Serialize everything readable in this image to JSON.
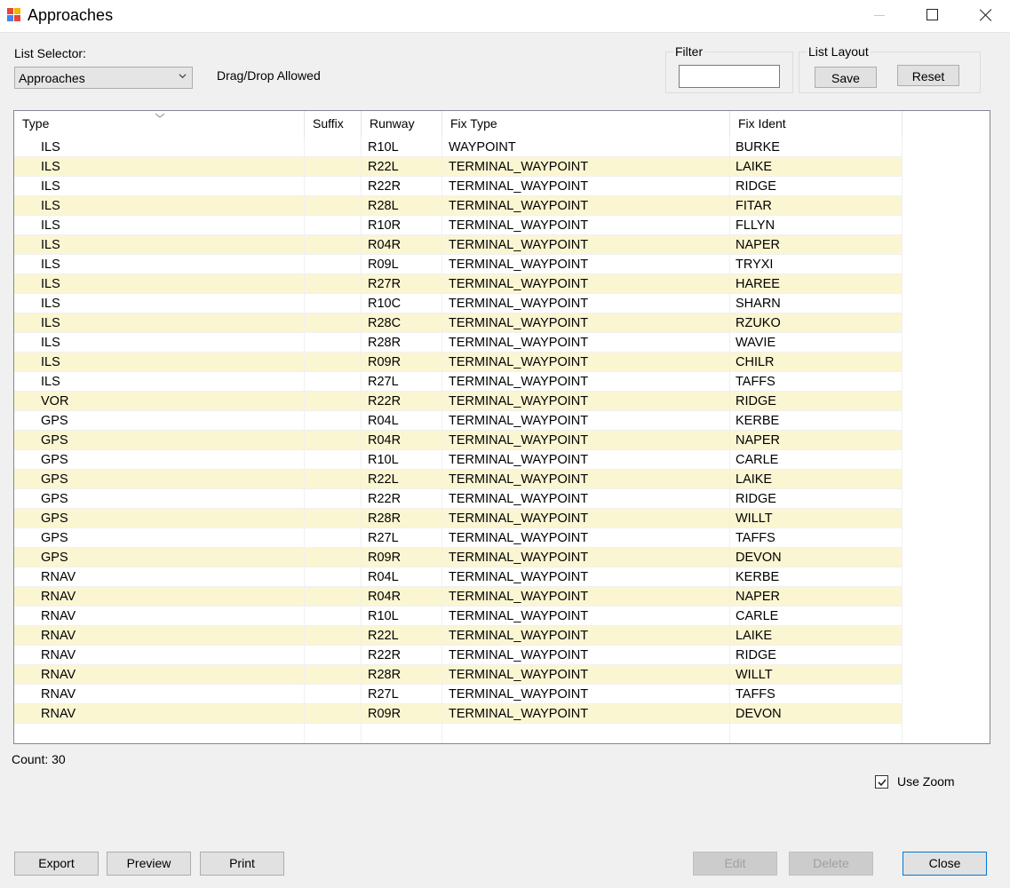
{
  "window": {
    "title": "Approaches"
  },
  "list_selector": {
    "label": "List Selector:",
    "value": "Approaches",
    "note": "Drag/Drop Allowed"
  },
  "filter": {
    "label": "Filter",
    "value": ""
  },
  "list_layout": {
    "label": "List Layout",
    "save_label": "Save",
    "reset_label": "Reset"
  },
  "grid": {
    "columns": [
      "Type",
      "Suffix",
      "Runway",
      "Fix Type",
      "Fix Ident"
    ],
    "rows": [
      [
        "ILS",
        "",
        "R10L",
        "WAYPOINT",
        "BURKE"
      ],
      [
        "ILS",
        "",
        "R22L",
        "TERMINAL_WAYPOINT",
        "LAIKE"
      ],
      [
        "ILS",
        "",
        "R22R",
        "TERMINAL_WAYPOINT",
        "RIDGE"
      ],
      [
        "ILS",
        "",
        "R28L",
        "TERMINAL_WAYPOINT",
        "FITAR"
      ],
      [
        "ILS",
        "",
        "R10R",
        "TERMINAL_WAYPOINT",
        "FLLYN"
      ],
      [
        "ILS",
        "",
        "R04R",
        "TERMINAL_WAYPOINT",
        "NAPER"
      ],
      [
        "ILS",
        "",
        "R09L",
        "TERMINAL_WAYPOINT",
        "TRYXI"
      ],
      [
        "ILS",
        "",
        "R27R",
        "TERMINAL_WAYPOINT",
        "HAREE"
      ],
      [
        "ILS",
        "",
        "R10C",
        "TERMINAL_WAYPOINT",
        "SHARN"
      ],
      [
        "ILS",
        "",
        "R28C",
        "TERMINAL_WAYPOINT",
        "RZUKO"
      ],
      [
        "ILS",
        "",
        "R28R",
        "TERMINAL_WAYPOINT",
        "WAVIE"
      ],
      [
        "ILS",
        "",
        "R09R",
        "TERMINAL_WAYPOINT",
        "CHILR"
      ],
      [
        "ILS",
        "",
        "R27L",
        "TERMINAL_WAYPOINT",
        "TAFFS"
      ],
      [
        "VOR",
        "",
        "R22R",
        "TERMINAL_WAYPOINT",
        "RIDGE"
      ],
      [
        "GPS",
        "",
        "R04L",
        "TERMINAL_WAYPOINT",
        "KERBE"
      ],
      [
        "GPS",
        "",
        "R04R",
        "TERMINAL_WAYPOINT",
        "NAPER"
      ],
      [
        "GPS",
        "",
        "R10L",
        "TERMINAL_WAYPOINT",
        "CARLE"
      ],
      [
        "GPS",
        "",
        "R22L",
        "TERMINAL_WAYPOINT",
        "LAIKE"
      ],
      [
        "GPS",
        "",
        "R22R",
        "TERMINAL_WAYPOINT",
        "RIDGE"
      ],
      [
        "GPS",
        "",
        "R28R",
        "TERMINAL_WAYPOINT",
        "WILLT"
      ],
      [
        "GPS",
        "",
        "R27L",
        "TERMINAL_WAYPOINT",
        "TAFFS"
      ],
      [
        "GPS",
        "",
        "R09R",
        "TERMINAL_WAYPOINT",
        "DEVON"
      ],
      [
        "RNAV",
        "",
        "R04L",
        "TERMINAL_WAYPOINT",
        "KERBE"
      ],
      [
        "RNAV",
        "",
        "R04R",
        "TERMINAL_WAYPOINT",
        "NAPER"
      ],
      [
        "RNAV",
        "",
        "R10L",
        "TERMINAL_WAYPOINT",
        "CARLE"
      ],
      [
        "RNAV",
        "",
        "R22L",
        "TERMINAL_WAYPOINT",
        "LAIKE"
      ],
      [
        "RNAV",
        "",
        "R22R",
        "TERMINAL_WAYPOINT",
        "RIDGE"
      ],
      [
        "RNAV",
        "",
        "R28R",
        "TERMINAL_WAYPOINT",
        "WILLT"
      ],
      [
        "RNAV",
        "",
        "R27L",
        "TERMINAL_WAYPOINT",
        "TAFFS"
      ],
      [
        "RNAV",
        "",
        "R09R",
        "TERMINAL_WAYPOINT",
        "DEVON"
      ]
    ]
  },
  "status": {
    "count_text": "Count: 30"
  },
  "use_zoom": {
    "label": "Use Zoom",
    "checked": true
  },
  "footer": {
    "export_label": "Export",
    "preview_label": "Preview",
    "print_label": "Print",
    "edit_label": "Edit",
    "delete_label": "Delete",
    "close_label": "Close"
  },
  "colors": {
    "alt_row": "#fbf6d2",
    "accent": "#0078d7"
  }
}
